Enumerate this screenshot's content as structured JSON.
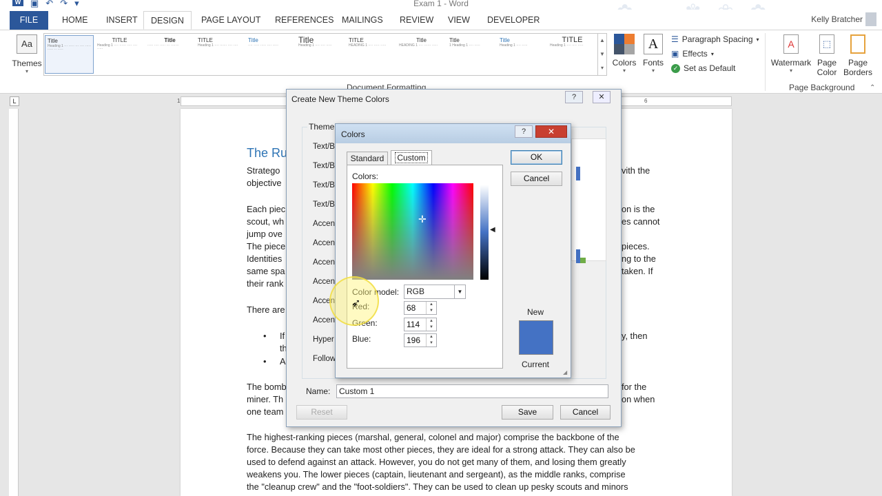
{
  "app": {
    "title": "Exam 1 - Word",
    "user": "Kelly Bratcher"
  },
  "tabs": [
    {
      "label": "FILE"
    },
    {
      "label": "HOME"
    },
    {
      "label": "INSERT"
    },
    {
      "label": "DESIGN"
    },
    {
      "label": "PAGE LAYOUT"
    },
    {
      "label": "REFERENCES"
    },
    {
      "label": "MAILINGS"
    },
    {
      "label": "REVIEW"
    },
    {
      "label": "VIEW"
    },
    {
      "label": "DEVELOPER"
    }
  ],
  "ribbon": {
    "themes_label": "Themes",
    "colors_label": "Colors",
    "fonts_label": "Fonts",
    "paragraph_spacing": "Paragraph Spacing",
    "effects": "Effects",
    "set_default": "Set as Default",
    "watermark": "Watermark",
    "page_color_1": "Page",
    "page_color_2": "Color",
    "page_borders_1": "Page",
    "page_borders_2": "Borders",
    "group_page_background": "Page Background",
    "group_doc_formatting": "Document Formatting",
    "gallery": [
      "Title",
      "TITLE",
      "Title",
      "TITLE",
      "Title",
      "Title",
      "TITLE",
      "Title",
      "Title",
      "Title",
      "TITLE"
    ]
  },
  "ruler": {
    "r1": "1",
    "r6": "6"
  },
  "document": {
    "heading": "The Ru",
    "lines": [
      "Stratego",
      "objective",
      "Each piec",
      "scout, wh",
      "jump ove",
      "The piece",
      "Identities",
      "same spa",
      "their rank",
      "There are",
      "If",
      "th",
      "A",
      "The bomb",
      "miner. Th",
      "one team"
    ],
    "right_lines": [
      "vith the",
      "on is the",
      "es cannot",
      "pieces.",
      "ng to the",
      "taken. If",
      "y, then",
      "for the",
      "on when"
    ],
    "para_full": [
      "The highest-ranking pieces (marshal, general, colonel and major) comprise the backbone of the",
      "force. Because they can take most other pieces, they are ideal for a strong attack. They can also be",
      "used to defend against an attack. However, you do not get many of them, and losing them greatly",
      "weakens you. The lower pieces (captain, lieutenant and sergeant), as the middle ranks, comprise",
      "the \"cleanup crew\" and the \"foot-soldiers\". They can be used to clean up pesky scouts and minors"
    ]
  },
  "theme_dialog": {
    "title": "Create New Theme Colors",
    "group_label": "Theme c",
    "rows": [
      "Text/B",
      "Text/B",
      "Text/B",
      "Text/B",
      "Accen",
      "Accen",
      "Accen",
      "Accen",
      "Accen",
      "Accen",
      "Hyper",
      "Follow"
    ],
    "name_label": "Name:",
    "name_value": "Custom 1",
    "reset": "Reset",
    "save": "Save",
    "cancel": "Cancel"
  },
  "colors_dialog": {
    "title": "Colors",
    "tab_standard": "Standard",
    "tab_custom": "Custom",
    "colors_label": "Colors:",
    "ok": "OK",
    "cancel": "Cancel",
    "color_model_label": "Color model:",
    "color_model": "RGB",
    "red_label": "Red:",
    "green_label": "Green:",
    "blue_label": "Blue:",
    "red": "68",
    "green": "114",
    "blue": "196",
    "new_label": "New",
    "current_label": "Current",
    "new_color": "#4472c4"
  }
}
